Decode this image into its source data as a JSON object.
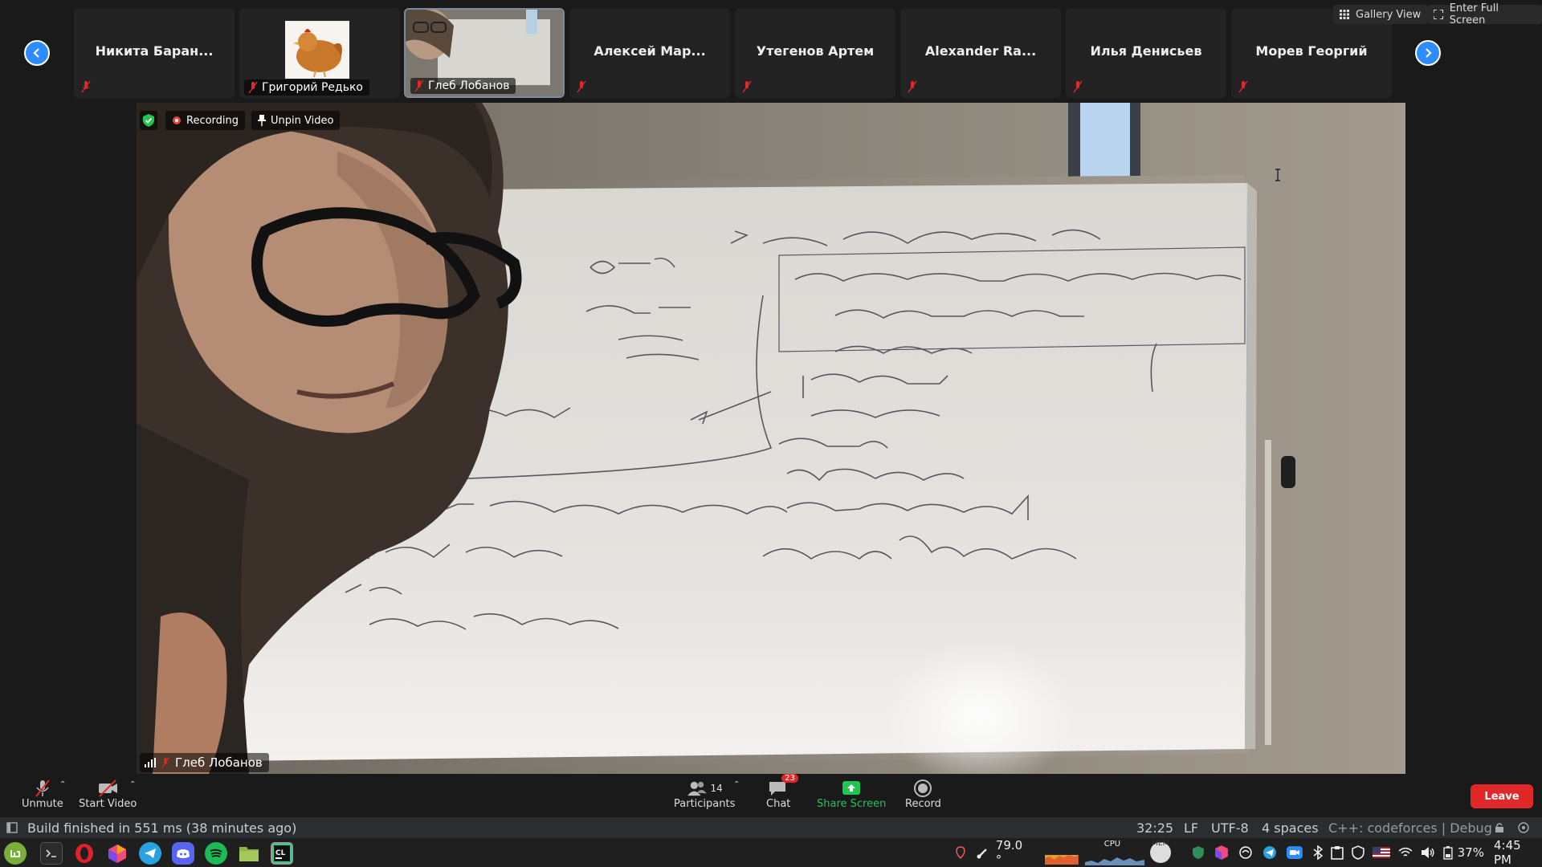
{
  "participants_strip": {
    "tiles": [
      {
        "name": "Никита Баран..."
      },
      {
        "name": "Григорий Редько"
      },
      {
        "name": "Глеб Лобанов"
      },
      {
        "name": "Алексей Мар..."
      },
      {
        "name": "Утегенов Артем"
      },
      {
        "name": "Alexander Ra..."
      },
      {
        "name": "Илья Денисьев"
      },
      {
        "name": "Морев Георгий"
      }
    ]
  },
  "view_controls": {
    "gallery_view": "Gallery View",
    "full_screen": "Enter Full Screen"
  },
  "video": {
    "recording_label": "Recording",
    "unpin_label": "Unpin Video",
    "speaker_name": "Глеб Лобанов",
    "whiteboard_lines": [
      "dp[n]",
      "dp2[n] -",
      "число",
      "вершин",
      "int calcdp(int u, int p)",
      "if g[u].size() == 1 && g[u][0]==p",
      "dp[u]=0   p2[u]=0",
      "return 0",
      "if dp[u] ≠ -1",
      "return dp[u]",
      "ans = 0",
      "for v : g[u]",
      "if v≠p",
      "ans = calcdp(v, u)+1",
      "return dp[u] = ans",
      "ns(int u, int p) {",
      "if",
      "if dp[v] ≠ -1  return (dp(u), dp2(u))",
      "for v in g(u)",
      "if v≠p",
      "auto (can, ord"
    ]
  },
  "toolbar": {
    "unmute": "Unmute",
    "start_video": "Start Video",
    "participants": "Participants",
    "participants_count": "14",
    "chat": "Chat",
    "chat_badge": "23",
    "share_screen": "Share Screen",
    "record": "Record",
    "leave": "Leave"
  },
  "ide_status": {
    "message": "Build finished in 551 ms (38 minutes ago)",
    "position": "32:25",
    "line_ending": "LF",
    "encoding": "UTF-8",
    "indent": "4 spaces",
    "context": "C++: codeforces | Debug"
  },
  "taskbar": {
    "temperature": "79.0 °",
    "cpu_label": "CPU",
    "mem_label": "MEM",
    "battery": "37%",
    "time": "4:45 PM"
  },
  "colors": {
    "accent_blue": "#2d8cff",
    "leave_red": "#e02828",
    "share_green": "#23c551",
    "recording_red": "#e5483a"
  }
}
